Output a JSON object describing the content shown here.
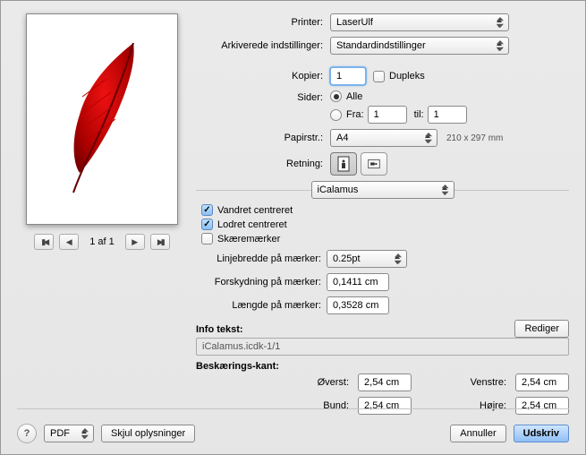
{
  "printer": {
    "label": "Printer:",
    "value": "LaserUlf"
  },
  "presets": {
    "label": "Arkiverede indstillinger:",
    "value": "Standardindstillinger"
  },
  "copies": {
    "label": "Kopier:",
    "value": "1",
    "duplex": "Dupleks"
  },
  "pages": {
    "label": "Sider:",
    "all": "Alle",
    "from": "Fra:",
    "to": "til:",
    "from_v": "1",
    "to_v": "1"
  },
  "paper": {
    "label": "Papirstr.:",
    "value": "A4",
    "dim": "210 x 297 mm"
  },
  "orientation": {
    "label": "Retning:"
  },
  "pane": {
    "value": "iCalamus"
  },
  "center_h": "Vandret centreret",
  "center_v": "Lodret centreret",
  "cropmarks": "Skæremærker",
  "linewidth": {
    "label": "Linjebredde på mærker:",
    "value": "0.25pt"
  },
  "offset": {
    "label": "Forskydning på mærker:",
    "value": "0,1411 cm"
  },
  "length": {
    "label": "Længde på mærker:",
    "value": "0,3528 cm"
  },
  "info": {
    "label": "Info tekst:",
    "edit": "Rediger",
    "value": "iCalamus.icdk-1/1"
  },
  "crop_edge": {
    "label": "Beskærings-kant:"
  },
  "margins": {
    "top": "Øverst:",
    "left": "Venstre:",
    "bottom": "Bund:",
    "right": "Højre:",
    "v": "2,54 cm"
  },
  "pager": {
    "count": "1 af 1"
  },
  "buttons": {
    "pdf": "PDF",
    "hide": "Skjul oplysninger",
    "cancel": "Annuller",
    "print": "Udskriv",
    "help": "?"
  }
}
